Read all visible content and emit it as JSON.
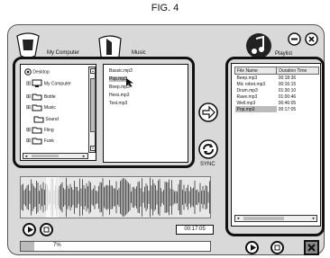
{
  "figure_label": "FIG. 4",
  "tabs": {
    "my_computer": "My Computer",
    "music": "Music",
    "playlist": "Playlist"
  },
  "tree": [
    {
      "label": "Desktop"
    },
    {
      "label": "My Computer"
    },
    {
      "label": "Bottle"
    },
    {
      "label": "Music"
    },
    {
      "label": "Sound"
    },
    {
      "label": "Fling"
    },
    {
      "label": "Funk"
    }
  ],
  "files": [
    "Bassic.mp3",
    "Pop.mp3",
    "Beep.mp3",
    "Hexs.mp3",
    "Test.mp3"
  ],
  "selected_file": "Pop.mp3",
  "sync_label": "SYNC",
  "playlist": {
    "headers": [
      "File Name",
      "Duration Time"
    ],
    "rows": [
      {
        "name": "Beep.mp3",
        "time": "00:18:36"
      },
      {
        "name": "Mic robot.mp3",
        "time": "00:16:15"
      },
      {
        "name": "Drum.mp3",
        "time": "01:30:10"
      },
      {
        "name": "Rave.mp3",
        "time": "01:00:46"
      },
      {
        "name": "Well.mp3",
        "time": "00:46:05"
      },
      {
        "name": "Pop.mp3",
        "time": "00:17:05"
      }
    ]
  },
  "player": {
    "time": "00:17:05",
    "progress_label": "7%",
    "progress_fraction": 0.07
  },
  "icons": {
    "my_computer_tab": "computer-icon",
    "music_tab": "music-icon",
    "playlist_tab": "music-note-icon",
    "minimize": "minimize-icon",
    "close": "close-icon",
    "transfer": "arrow-right-icon",
    "sync": "sync-icon",
    "play": "play-icon",
    "stop": "stop-icon",
    "delete": "delete-icon"
  }
}
